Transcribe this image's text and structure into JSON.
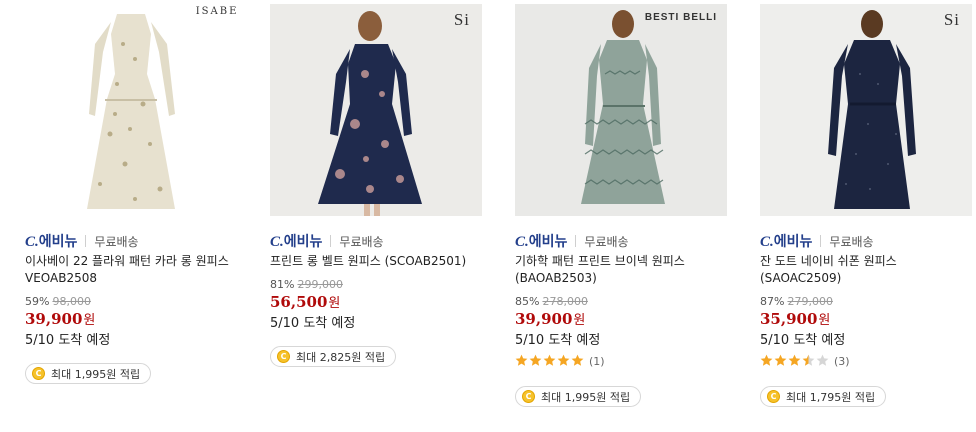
{
  "products": [
    {
      "brand_logo": "ISABEY",
      "seller": {
        "prefix": "C.",
        "name": "에비뉴"
      },
      "shipping": "무료배송",
      "title": "이사베이 22 플라워 패턴 카라 롱 원피스 VEOAB2508",
      "discount_rate": "59%",
      "original_price": "98,000",
      "price": "39,900",
      "currency": "원",
      "delivery": "5/10 도착 예정",
      "rating": null,
      "points": "최대 1,995원 적립",
      "coin_icon": "coin-icon"
    },
    {
      "brand_logo": "Si",
      "seller": {
        "prefix": "C.",
        "name": "에비뉴"
      },
      "shipping": "무료배송",
      "title": "프린트 롱 벨트 원피스 (SCOAB2501)",
      "discount_rate": "81%",
      "original_price": "299,000",
      "price": "56,500",
      "currency": "원",
      "delivery": "5/10 도착 예정",
      "rating": null,
      "points": "최대 2,825원 적립",
      "coin_icon": "coin-icon"
    },
    {
      "brand_logo": "BESTI BELLI",
      "seller": {
        "prefix": "C.",
        "name": "에비뉴"
      },
      "shipping": "무료배송",
      "title": "기하학 패턴 프린트 브이넥 원피스 (BAOAB2503)",
      "discount_rate": "85%",
      "original_price": "278,000",
      "price": "39,900",
      "currency": "원",
      "delivery": "5/10 도착 예정",
      "rating": {
        "stars": 5,
        "count": "(1)"
      },
      "points": "최대 1,995원 적립",
      "coin_icon": "coin-icon"
    },
    {
      "brand_logo": "Si",
      "seller": {
        "prefix": "C.",
        "name": "에비뉴"
      },
      "shipping": "무료배송",
      "title": "잔 도트 네이비 쉬폰 원피스 (SAOAC2509)",
      "discount_rate": "87%",
      "original_price": "279,000",
      "price": "35,900",
      "currency": "원",
      "delivery": "5/10 도착 예정",
      "rating": {
        "stars": 3.5,
        "count": "(3)"
      },
      "points": "최대 1,795원 적립",
      "coin_icon": "coin-icon"
    }
  ],
  "colors": {
    "price": "#b00a0a",
    "seller": "#233f8b",
    "star": "#f5a623",
    "star_empty": "#d6d6d6",
    "coin": "#f6c22b"
  }
}
